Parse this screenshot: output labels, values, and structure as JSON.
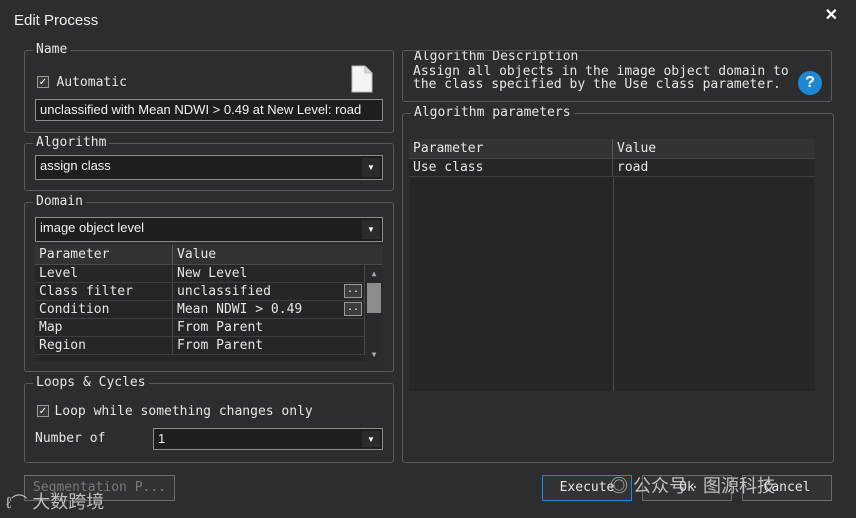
{
  "window": {
    "title": "Edit Process",
    "close_glyph": "✕"
  },
  "name_group": {
    "legend": "Name",
    "automatic_label": "Automatic",
    "automatic_checked": true,
    "value": "unclassified with Mean NDWI > 0.49  at New Level: road",
    "doc_icon": "document-icon"
  },
  "algorithm_group": {
    "legend": "Algorithm",
    "value": "assign class"
  },
  "domain_group": {
    "legend": "Domain",
    "value": "image object level",
    "columns": [
      "Parameter",
      "Value"
    ],
    "rows": [
      {
        "param": "Level",
        "value": "New Level"
      },
      {
        "param": "Class filter",
        "value": "unclassified"
      },
      {
        "param": "Condition",
        "value": "Mean NDWI > 0.49"
      },
      {
        "param": "Map",
        "value": "From Parent"
      },
      {
        "param": "Region",
        "value": "From Parent"
      }
    ],
    "ellipsis": ".."
  },
  "loops_group": {
    "legend": "Loops & Cycles",
    "loop_label": "Loop while something changes only",
    "loop_checked": true,
    "number_label": "Number of",
    "number_value": "1"
  },
  "description_group": {
    "legend": "Algorithm Description",
    "text": "Assign all objects in the image object domain to the class specified by the Use class parameter.",
    "help_icon": "help-icon",
    "help_glyph": "?"
  },
  "params_group": {
    "legend": "Algorithm parameters",
    "columns": [
      "Parameter",
      "Value"
    ],
    "rows": [
      {
        "param": "Use class",
        "value": "road"
      }
    ]
  },
  "buttons": {
    "segmentation": "Segmentation P...",
    "execute": "Execute",
    "ok": "Ok",
    "cancel": "Cancel"
  },
  "watermarks": {
    "left": "大数跨境",
    "right": "公众号 · 图源科技"
  },
  "colors": {
    "background": "#2d2d30",
    "accent": "#1e88d4",
    "field": "#1e1e1e"
  }
}
